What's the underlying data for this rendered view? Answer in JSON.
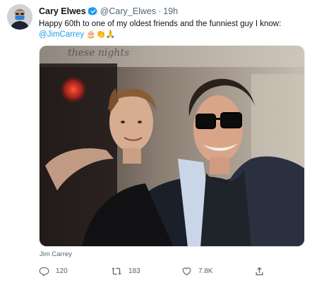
{
  "tweet": {
    "author_name": "Cary Elwes",
    "handle": "@Cary_Elwes",
    "separator": "·",
    "time": "19h",
    "text": "Happy 60th to one of my oldest friends and the funniest guy I know:",
    "mention": "@JimCarrey",
    "emojis": "🎂👏🙏",
    "photo_caption": "Jim Carrey"
  },
  "actions": {
    "replies": "120",
    "retweets": "183",
    "likes": "7.8K"
  },
  "icons": {
    "verified": "verified-badge-icon",
    "reply": "reply-icon",
    "retweet": "retweet-icon",
    "like": "heart-icon",
    "share": "share-icon"
  },
  "colors": {
    "accent": "#1d9bf0",
    "secondary_text": "#536471",
    "primary_text": "#0f1419"
  }
}
